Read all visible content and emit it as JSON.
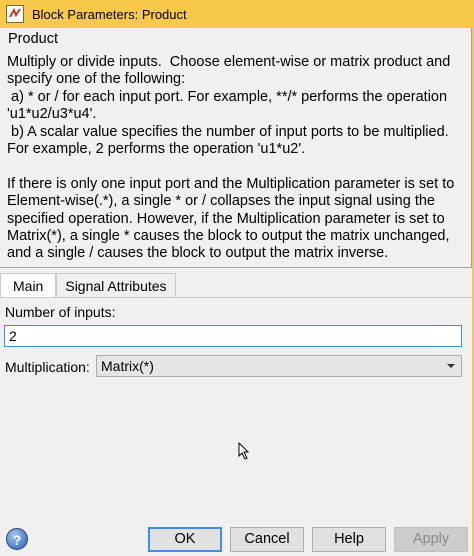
{
  "window": {
    "title": "Block Parameters: Product",
    "icon": "block-parameters-icon"
  },
  "description": {
    "block_name": "Product",
    "text": "Multiply or divide inputs.  Choose element-wise or matrix product and\nspecify one of the following:\n a) * or / for each input port. For example, **/* performs the operation\n'u1*u2/u3*u4'.\n b) A scalar value specifies the number of input ports to be multiplied.\nFor example, 2 performs the operation 'u1*u2'.\n\nIf there is only one input port and the Multiplication parameter is set to\nElement-wise(.*), a single * or / collapses the input signal using the\nspecified operation. However, if the Multiplication parameter is set to\nMatrix(*), a single * causes the block to output the matrix unchanged,\nand a single / causes the block to output the matrix inverse."
  },
  "tabs": [
    {
      "label": "Main",
      "active": true
    },
    {
      "label": "Signal Attributes",
      "active": false
    }
  ],
  "main": {
    "inputs_label": "Number of inputs:",
    "inputs_value": "2",
    "multiplication_label": "Multiplication:",
    "multiplication_value": "Matrix(*)"
  },
  "buttons": {
    "ok": "OK",
    "cancel": "Cancel",
    "help": "Help",
    "apply": "Apply",
    "help_icon": "?"
  },
  "colors": {
    "titlebar": "#f7c84a",
    "focus": "#3c8ee6"
  }
}
